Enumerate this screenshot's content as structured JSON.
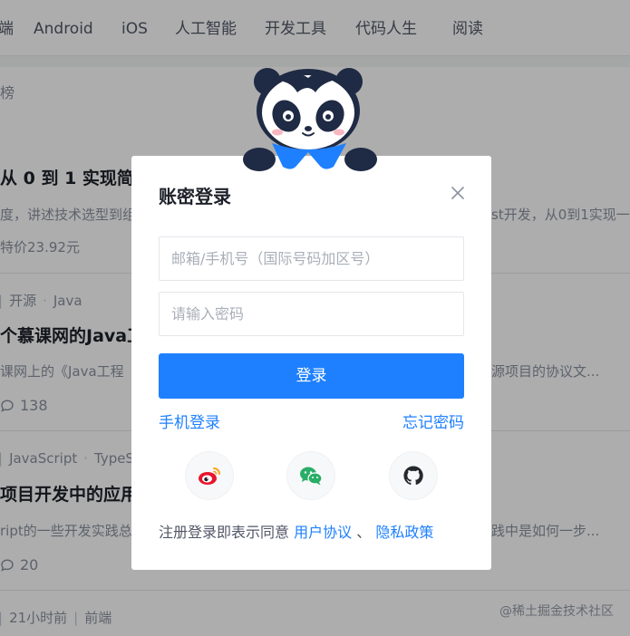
{
  "nav": {
    "items": [
      "端",
      "Android",
      "iOS",
      "人工智能",
      "开发工具",
      "代码人生",
      "阅读"
    ]
  },
  "subnav": {
    "label": "榜"
  },
  "articles": [
    {
      "title": "从 0 到 1 实现简",
      "abstract": "度，讲述技术选型到组",
      "abstract_right": "st开发，从0到1实现一",
      "price": "特价23.92元"
    },
    {
      "meta": [
        "开源",
        "Java"
      ],
      "title": "个慕课网的Java工",
      "abstract": "课网上的《Java工程",
      "abstract_right": "源项目的协议文...",
      "comments": "138"
    },
    {
      "meta": [
        "JavaScript",
        "TypeS"
      ],
      "title": "项目开发中的应用",
      "abstract": "ript的一些开发实践总",
      "abstract_right": "践中是如何一步...",
      "comments": "20"
    },
    {
      "meta": [
        "21小时前",
        "前端"
      ]
    }
  ],
  "watermark": "@稀土掘金技术社区",
  "modal": {
    "title": "账密登录",
    "account_placeholder": "邮箱/手机号（国际号码加区号）",
    "password_placeholder": "请输入密码",
    "login_label": "登录",
    "phone_login": "手机登录",
    "forgot_password": "忘记密码",
    "agree_text": "注册登录即表示同意",
    "user_agreement": "用户协议",
    "separator": "、",
    "privacy_policy": "隐私政策"
  },
  "colors": {
    "accent": "#1e80ff",
    "weibo": "#e6162d",
    "wechat": "#2aae67",
    "github": "#24292e"
  }
}
